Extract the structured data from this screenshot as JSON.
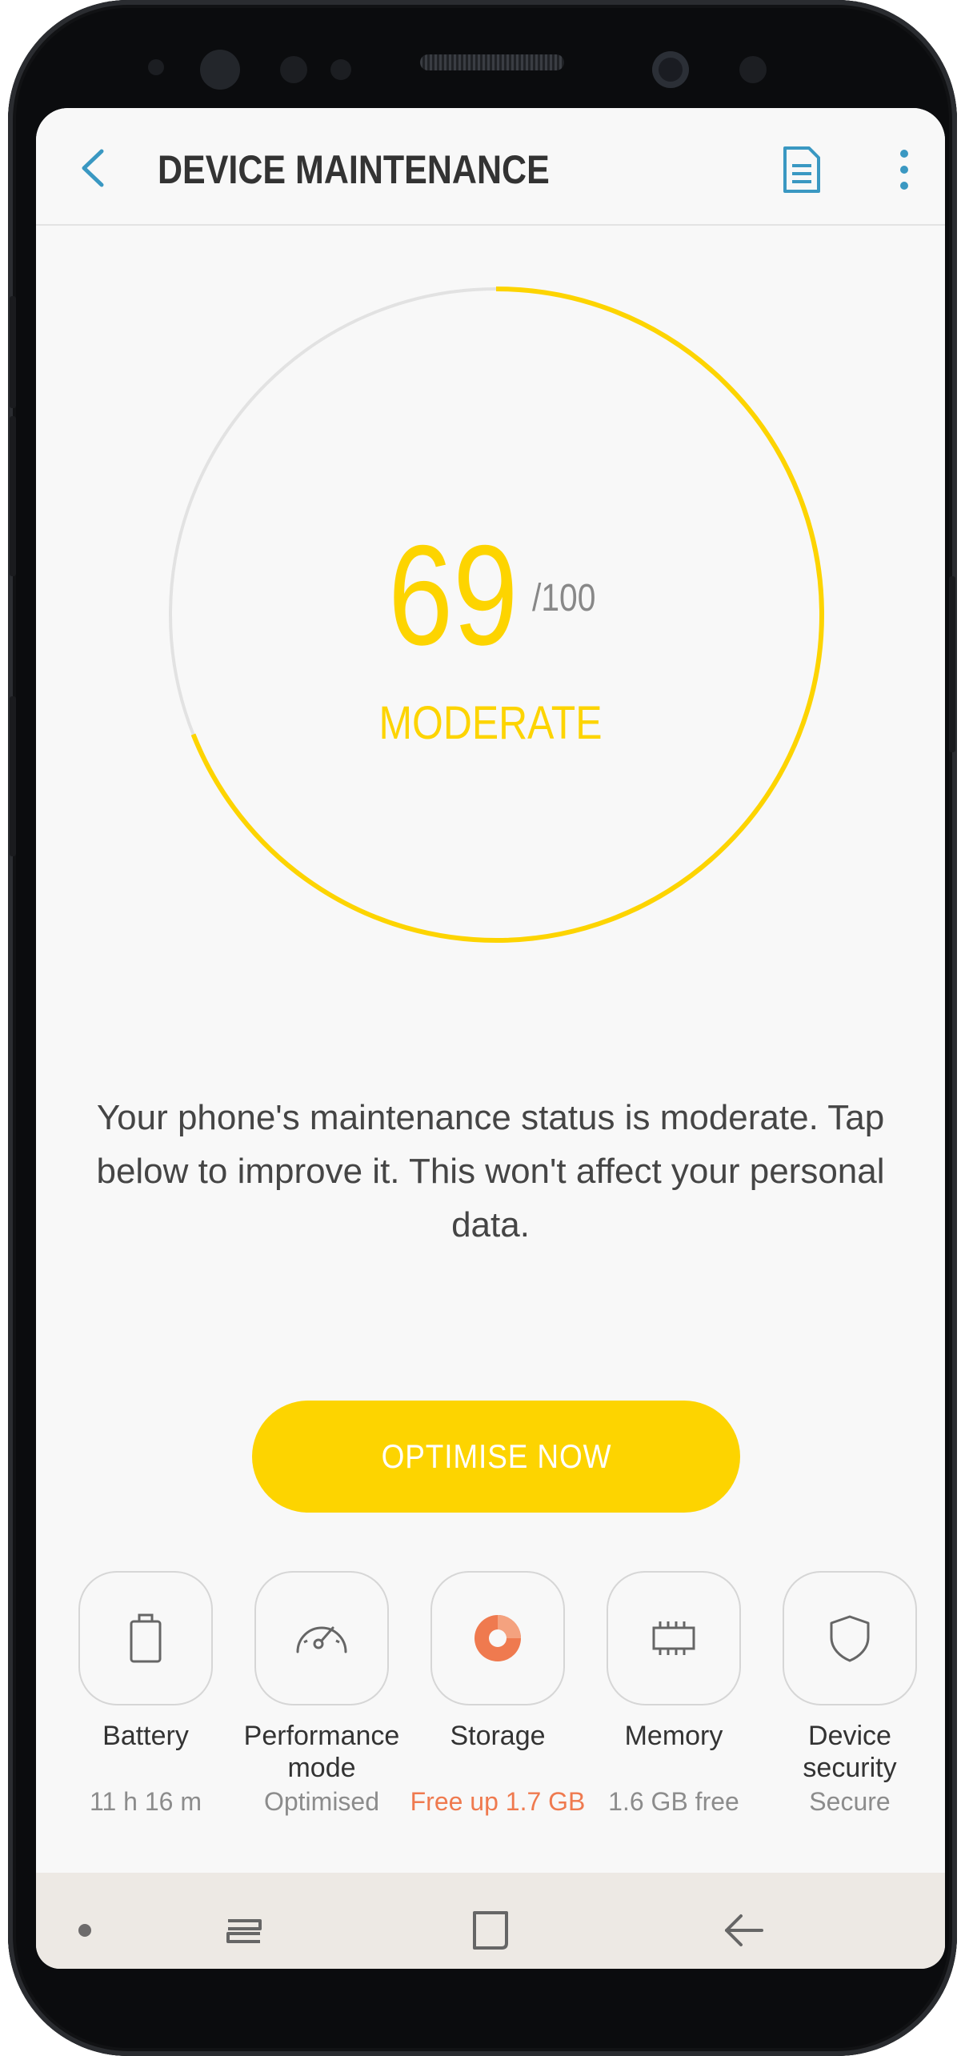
{
  "header": {
    "title": "DEVICE MAINTENANCE",
    "back_icon": "chevron-left-icon",
    "report_icon": "document-icon",
    "more_icon": "more-vertical-icon"
  },
  "score": {
    "value": "69",
    "max": "/100",
    "status": "MODERATE",
    "progress_fraction": 0.69,
    "color": "#fdd400"
  },
  "message": "Your phone's maintenance status is moderate. Tap below to improve it. This won't affect your personal data.",
  "action": {
    "label": "OPTIMISE NOW",
    "color": "#fdd400"
  },
  "tiles": [
    {
      "label": "Battery",
      "value": "11 h 16 m",
      "icon": "battery-icon"
    },
    {
      "label": "Performance mode",
      "value": "Optimised",
      "icon": "speedometer-icon"
    },
    {
      "label": "Storage",
      "value": "Free up 1.7 GB",
      "icon": "storage-pie-icon",
      "status_color": "#ef7a4f"
    },
    {
      "label": "Memory",
      "value": "1.6 GB free",
      "icon": "memory-chip-icon"
    },
    {
      "label": "Device security",
      "value": "Secure",
      "icon": "shield-icon"
    }
  ],
  "navbar": {
    "dot_icon": "nav-dot-icon",
    "recent_icon": "recent-apps-icon",
    "home_icon": "home-icon",
    "back_icon": "back-arrow-icon"
  }
}
